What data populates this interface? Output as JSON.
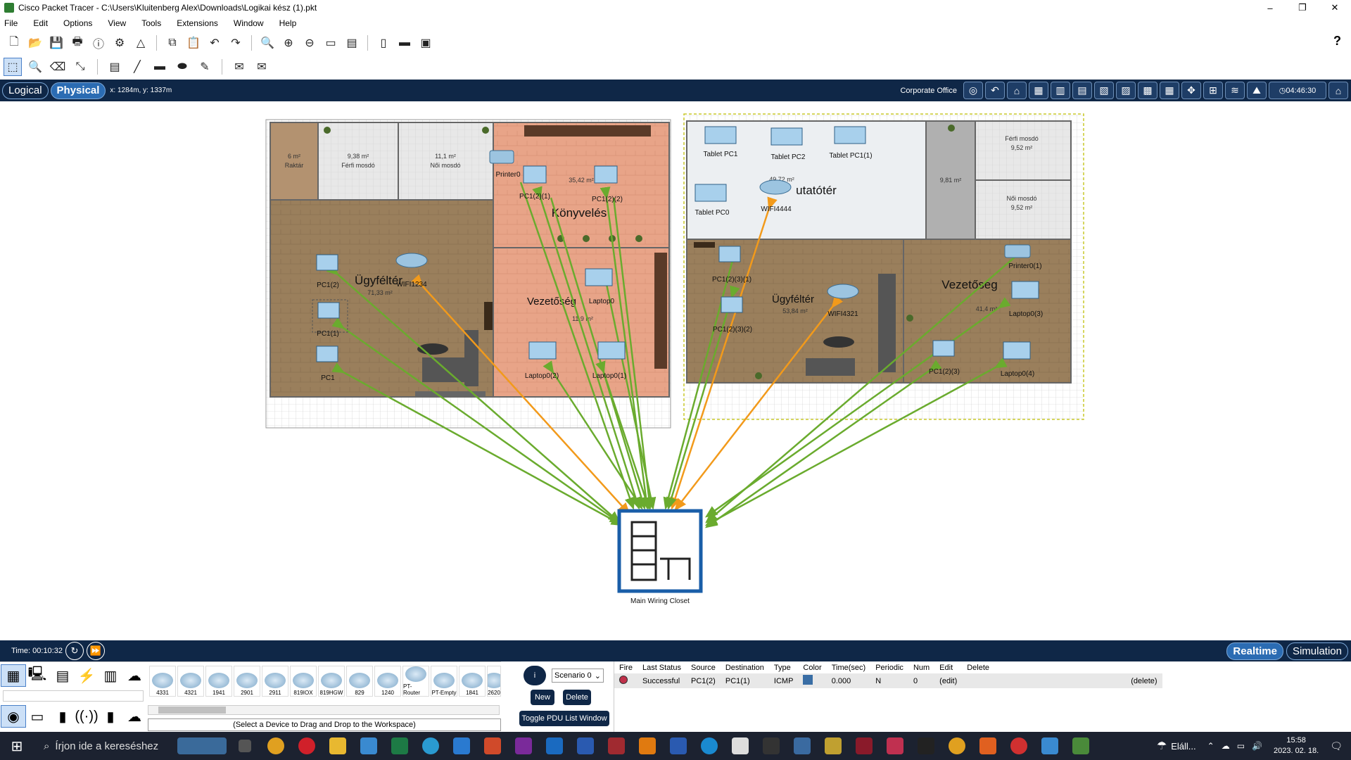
{
  "window": {
    "title": "Cisco Packet Tracer - C:\\Users\\Kluitenberg Alex\\Downloads\\Logikai kész (1).pkt",
    "minimize": "–",
    "maximize": "❐",
    "close": "✕"
  },
  "menu": [
    "File",
    "Edit",
    "Options",
    "View",
    "Tools",
    "Extensions",
    "Window",
    "Help"
  ],
  "nav": {
    "logical": "Logical",
    "physical": "Physical",
    "coords": "x: 1284m, y: 1337m",
    "location": "Corporate Office",
    "clock": "04:46:30"
  },
  "rooms": {
    "raktar": "Raktár",
    "raktar_area": "6 m²",
    "ferfi": "Férfi mosdó",
    "ferfi_area": "9,38 m²",
    "noi": "Női mosdó",
    "noi_area": "11,1 m²",
    "ugyfelter_left": "Ügyféltér",
    "ugyfelter_left_area": "71,33 m²",
    "konyveles": "Könyvelés",
    "konyveles_area": "35,42 m²",
    "vezetoseg_left": "Vezetőség",
    "vezetoseg_left_area": "11,9 m²",
    "bemutato": "utatótér",
    "bemutato_area": "49,72 m²",
    "small_area": "9,81 m²",
    "ferfi_r": "Férfi mosdó",
    "ferfi_r_area": "9,52 m²",
    "noi_r": "Női mosdó",
    "noi_r_area": "9,52 m²",
    "ugyfelter_right": "Ügyféltér",
    "ugyfelter_right_area": "53,84 m²",
    "vezetoseg_right": "Vezetőség",
    "vezetoseg_right_area": "41,4 m²"
  },
  "devices": {
    "printer0": "Printer0",
    "pc1_2_1": "PC1(2)(1)",
    "pc1_2_2": "PC1(2)(2)",
    "pc1_2": "PC1(2)",
    "pc1_1": "PC1(1)",
    "pc1": "PC1",
    "wifi1234": "WIFI1234",
    "laptop0": "Laptop0",
    "laptop0_2": "Laptop0(2)",
    "laptop0_1": "Laptop0(1)",
    "tablet_pc1": "Tablet PC1",
    "tablet_pc2": "Tablet PC2",
    "tablet_pc1_1": "Tablet PC1(1)",
    "tablet_pc0": "Tablet PC0",
    "wifi4444": "WIFI4444",
    "pc1_2_3_1": "PC1(2)(3)(1)",
    "pc1_2_3_2": "PC1(2)(3)(2)",
    "wifi4321": "WIFI4321",
    "printer0_1": "Printer0(1)",
    "laptop0_3": "Laptop0(3)",
    "pc1_2_3": "PC1(2)(3)",
    "laptop0_4": "Laptop0(4)",
    "closet": "Main Wiring Closet"
  },
  "bottom": {
    "time": "Time: 00:10:32",
    "realtime": "Realtime",
    "simulation": "Simulation"
  },
  "device_models": [
    "4331",
    "4321",
    "1941",
    "2901",
    "2911",
    "819IOX",
    "819HGW",
    "829",
    "1240",
    "PT-Router",
    "PT-Empty",
    "1841",
    "2620"
  ],
  "hint": "(Select a Device to Drag and Drop to the Workspace)",
  "scenario": {
    "info": "i",
    "select": "Scenario 0",
    "new": "New",
    "delete": "Delete",
    "toggle": "Toggle PDU List Window"
  },
  "pdu": {
    "headers": [
      "Fire",
      "Last Status",
      "Source",
      "Destination",
      "Type",
      "Color",
      "Time(sec)",
      "Periodic",
      "Num",
      "Edit",
      "Delete"
    ],
    "row": {
      "status": "Successful",
      "source": "PC1(2)",
      "dest": "PC1(1)",
      "type": "ICMP",
      "color_hex": "#3a6ea5",
      "time": "0.000",
      "periodic": "N",
      "num": "0",
      "edit": "(edit)",
      "delete": "(delete)"
    }
  },
  "taskbar": {
    "search_placeholder": "Írjon ide a kereséshez",
    "weather": "Eláll...",
    "time": "15:58",
    "date": "2023. 02. 18."
  },
  "colors": {
    "nav_bg": "#0f2747",
    "link_green": "#6aab2e",
    "link_orange": "#f29a1b",
    "floor_wood": "#9a7f5c",
    "floor_orange": "#e8a488",
    "floor_white": "#eceff2"
  }
}
